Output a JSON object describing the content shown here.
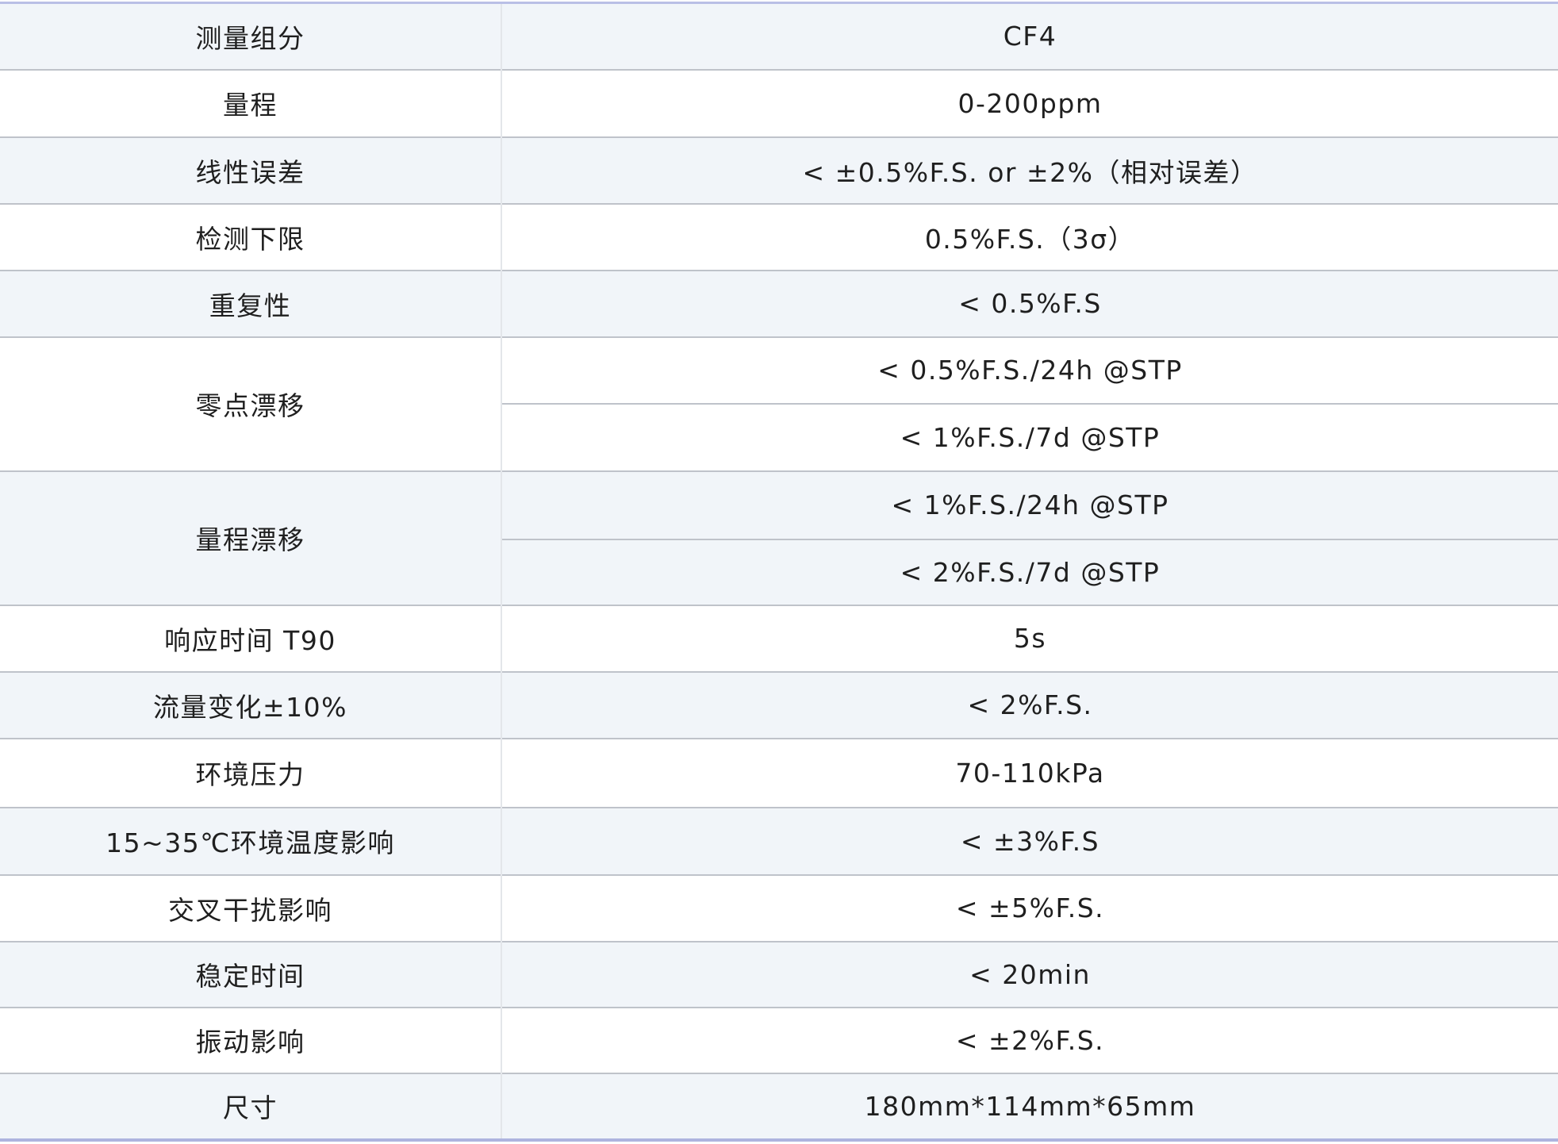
{
  "rows": [
    {
      "name": "测量组分",
      "value": "CF4"
    },
    {
      "name": "量程",
      "value": "0-200ppm"
    },
    {
      "name": "线性误差",
      "value": "< ±0.5%F.S. or ±2%（相对误差）"
    },
    {
      "name": "检测下限",
      "value": "0.5%F.S.（3σ）"
    },
    {
      "name": "重复性",
      "value": "< 0.5%F.S"
    },
    {
      "name": "零点漂移",
      "values": [
        "< 0.5%F.S./24h @STP",
        "< 1%F.S./7d @STP"
      ]
    },
    {
      "name": "量程漂移",
      "values": [
        "< 1%F.S./24h @STP",
        "< 2%F.S./7d @STP"
      ]
    },
    {
      "name": "响应时间 T90",
      "value": "5s"
    },
    {
      "name": "流量变化±10%",
      "value": "< 2%F.S."
    },
    {
      "name": "环境压力",
      "value": "70-110kPa"
    },
    {
      "name": "15~35℃环境温度影响",
      "value": "< ±3%F.S"
    },
    {
      "name": "交叉干扰影响",
      "value": "< ±5%F.S."
    },
    {
      "name": "稳定时间",
      "value": "< 20min"
    },
    {
      "name": "振动影响",
      "value": "< ±2%F.S."
    },
    {
      "name": "尺寸",
      "value": "180mm*114mm*65mm"
    }
  ],
  "colors": {
    "shaded_row": "#f1f5f9",
    "row_border": "#bfc3ca",
    "edge_border": "#b9bfe6"
  }
}
